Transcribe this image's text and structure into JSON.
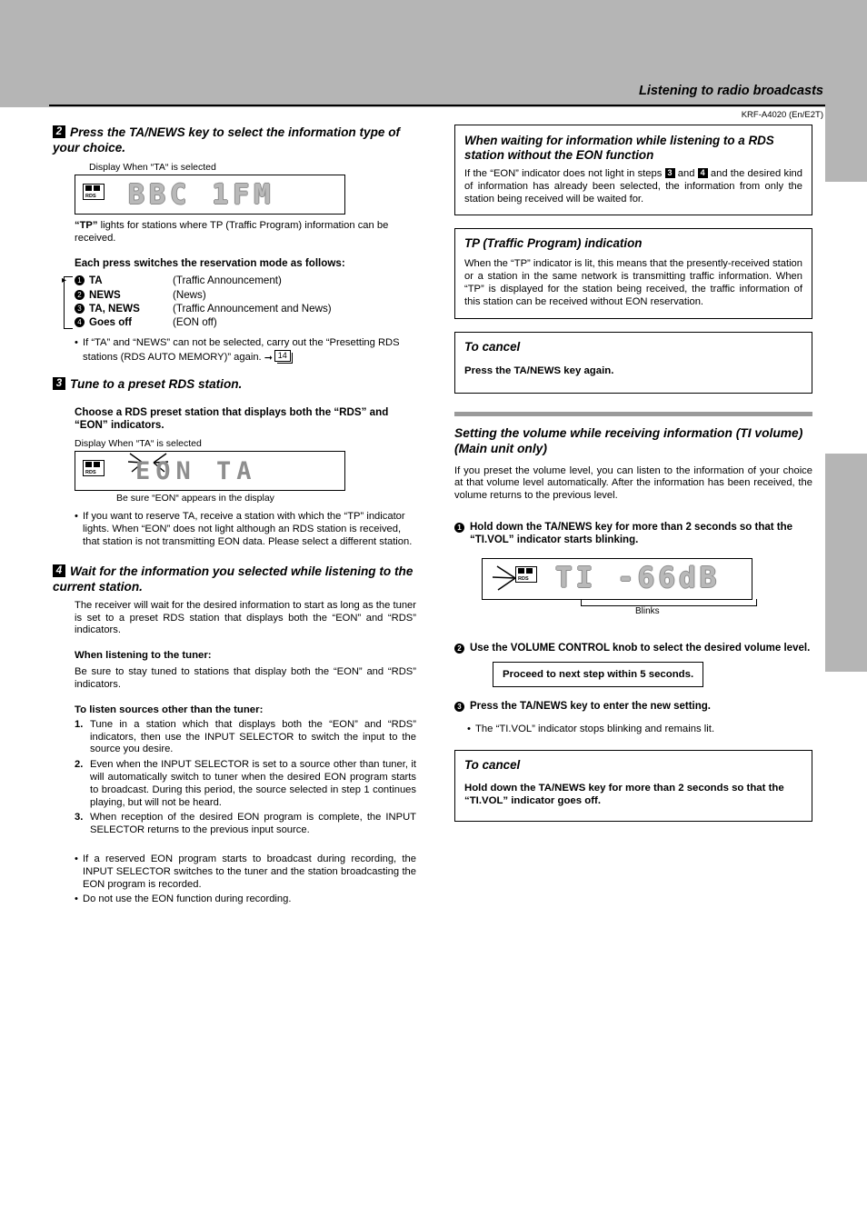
{
  "header": {
    "title": "Listening to radio broadcasts",
    "model": "KRF-A4020 (En/E2T)"
  },
  "left": {
    "step2": {
      "num": "2",
      "heading": "Press the TA/NEWS key to select the information type of your choice.",
      "display_label": "Display When “TA“ is selected",
      "lcd_text": "BBC  1FM",
      "tp_badge": "RDS",
      "note": "lights for stations where TP (Traffic Program) information can be received.",
      "note_lead": "“TP”",
      "modes_heading": "Each press switches the reservation mode as follows:",
      "modes": [
        {
          "num": "1",
          "name": "TA",
          "desc": "(Traffic Announcement)"
        },
        {
          "num": "2",
          "name": "NEWS",
          "desc": "(News)"
        },
        {
          "num": "3",
          "name": "TA, NEWS",
          "desc": "(Traffic Announcement and News)"
        },
        {
          "num": "4",
          "name": "Goes off",
          "desc": "(EON off)"
        }
      ],
      "bullet": "If “TA” and “NEWS” can not be selected, carry out the “Presetting RDS stations (RDS AUTO MEMORY)” again.",
      "page_ref": "14"
    },
    "step3": {
      "num": "3",
      "heading": "Tune to a preset RDS station.",
      "subheading": "Choose a RDS preset station that displays both the “RDS” and “EON” indicators.",
      "display_label": "Display When “TA“ is selected",
      "lcd_text": "EON  TA",
      "caption": "Be sure “EON“ appears in the display",
      "bullet": "If you want to reserve TA, receive a station with which the “TP” indicator lights. When “EON” does not light although an RDS station is received, that station is not transmitting EON data. Please select a different station."
    },
    "step4": {
      "num": "4",
      "heading": "Wait for the information you selected while listening to the current station.",
      "para": "The receiver will wait for the desired information to start as long as the tuner is set to a preset RDS station that displays both the “EON” and “RDS” indicators.",
      "sub1": "When listening to the tuner:",
      "sub1_para": "Be sure to stay tuned to stations that display both the “EON” and “RDS” indicators.",
      "sub2": "To listen sources other than the tuner:",
      "items": [
        {
          "n": "1.",
          "t": "Tune in a station which that displays both the “EON” and “RDS” indicators, then use the INPUT SELECTOR to switch the input to the source you desire."
        },
        {
          "n": "2.",
          "t": "Even when the INPUT SELECTOR is set to a source other than tuner, it will automatically switch to tuner when the desired EON program starts to broadcast. During this period, the source selected in step 1 continues playing, but will not be heard."
        },
        {
          "n": "3.",
          "t": "When reception of the desired EON program is complete, the INPUT SELECTOR returns to the previous input source."
        }
      ],
      "dots": [
        "If a reserved EON program starts to broadcast during recording, the INPUT SELECTOR switches to the tuner and the station broadcasting the EON program is recorded.",
        "Do not use the EON function during recording."
      ]
    }
  },
  "right": {
    "box1": {
      "heading": "When waiting for information while listening to a RDS station without the EON  function",
      "text_parts": {
        "a": "If the “EON” indicator does not light in steps ",
        "n1": "3",
        "b": " and ",
        "n2": "4",
        "c": " and the desired kind of information has already been selected, the information from only the station being received will be waited for."
      }
    },
    "box2": {
      "heading": "TP (Traffic Program) indication",
      "text": "When the “TP” indicator is lit, this means that the presently-received station or a station in the same network is transmitting traffic information. When “TP” is displayed for the station being received, the traffic information of this station can be received without EON reservation."
    },
    "box3": {
      "heading": "To cancel",
      "text": "Press the TA/NEWS key again."
    },
    "section": {
      "heading": "Setting the volume while receiving information (TI volume) (Main unit only)",
      "intro": "If you preset the volume level, you can listen to the information of your choice at that volume level automatically. After the information has been received, the volume returns to the previous level.",
      "steps": [
        {
          "num": "1",
          "text": "Hold down the TA/NEWS key for more than 2 seconds so that the “TI.VOL” indicator starts blinking."
        },
        {
          "num": "2",
          "text": "Use the VOLUME CONTROL knob to select the desired volume level."
        },
        {
          "num": "3",
          "text": "Press the TA/NEWS key to enter the new setting."
        }
      ],
      "lcd_text": "TI  -66dB",
      "lcd_badge": "RDS",
      "blinks_label": "Blinks",
      "notice": "Proceed to next step within 5 seconds.",
      "dot": "The “TI.VOL” indicator stops blinking and remains lit."
    },
    "box4": {
      "heading": "To cancel",
      "text": "Hold down the TA/NEWS key for more than 2 seconds so that the “TI.VOL” indicator goes off."
    }
  }
}
